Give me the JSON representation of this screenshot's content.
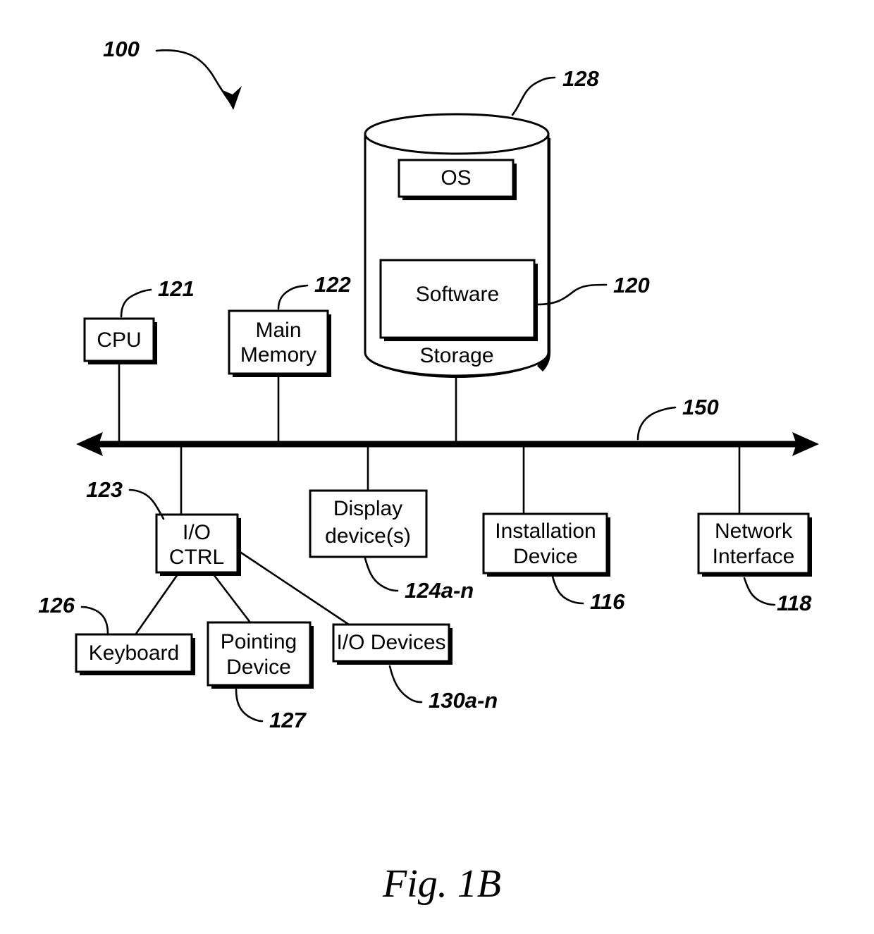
{
  "figure": {
    "caption": "Fig. 1B",
    "system_ref": "100"
  },
  "nodes": {
    "cpu": {
      "label": "CPU",
      "ref": "121"
    },
    "main_memory": {
      "label": "Main\nMemory",
      "line1": "Main",
      "line2": "Memory",
      "ref": "122"
    },
    "storage": {
      "label": "Storage",
      "ref": "128"
    },
    "os": {
      "label": "OS"
    },
    "software": {
      "label": "Software",
      "ref": "120"
    },
    "io_ctrl": {
      "line1": "I/O",
      "line2": "CTRL",
      "ref": "123"
    },
    "display_devices": {
      "line1": "Display",
      "line2": "device(s)",
      "ref": "124a-n"
    },
    "installation_device": {
      "line1": "Installation",
      "line2": "Device",
      "ref": "116"
    },
    "network_interface": {
      "line1": "Network",
      "line2": "Interface",
      "ref": "118"
    },
    "keyboard": {
      "label": "Keyboard",
      "ref": "126"
    },
    "pointing_device": {
      "line1": "Pointing",
      "line2": "Device",
      "ref": "127"
    },
    "io_devices": {
      "label": "I/O Devices",
      "ref": "130a-n"
    },
    "bus": {
      "ref": "150"
    }
  },
  "colors": {
    "stroke": "#000000",
    "fill": "#ffffff",
    "shadow": "#000000"
  }
}
